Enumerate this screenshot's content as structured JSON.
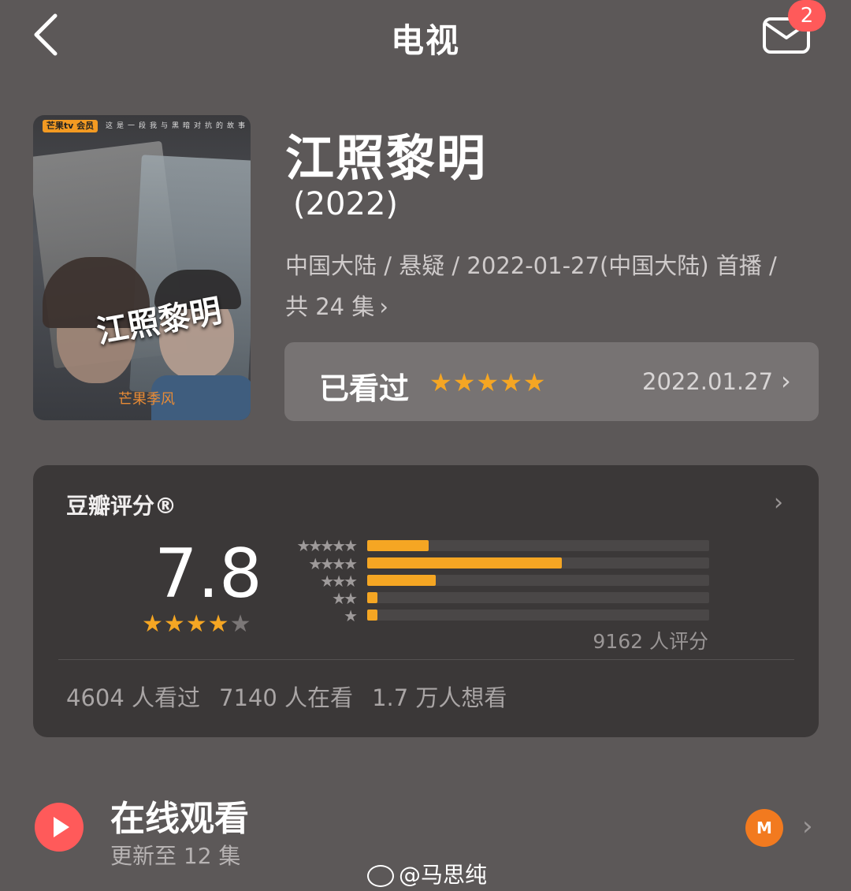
{
  "header": {
    "title": "电视",
    "badge_count": "2"
  },
  "poster": {
    "platform_logo": "芒果tv 会员",
    "tagline": "这是一段我与黑暗对抗的故事",
    "calligraphy_title": "江照黎明",
    "sub_brand": "芒果季风"
  },
  "show": {
    "title": "江照黎明",
    "year": "(2022)",
    "meta_line1": "中国大陆 / 悬疑 / 2022-01-27(中国大陆) 首播 /",
    "meta_line2": "共 24 集"
  },
  "watched": {
    "label": "已看过",
    "stars": "★★★★★",
    "date": "2022.01.27"
  },
  "rating": {
    "title": "豆瓣评分®",
    "score": "7.8",
    "stars_on": "★★★★",
    "stars_off": "★",
    "rating_count": "9162 人评分",
    "distribution_stars": [
      "★★★★★",
      "★★★★",
      "★★★",
      "★★",
      "★"
    ],
    "distribution_fraction": [
      0.18,
      0.57,
      0.2,
      0.03,
      0.03
    ],
    "stats": {
      "watched": "4604 人看过",
      "watching": "7140 人在看",
      "wish": "1.7 万人想看"
    },
    "accent_color": "#f5a623"
  },
  "online": {
    "title": "在线观看",
    "subtitle": "更新至 12 集",
    "provider_icon": "mango-tv-icon",
    "provider_logo_text": "M"
  },
  "watermark": "@马思纯"
}
